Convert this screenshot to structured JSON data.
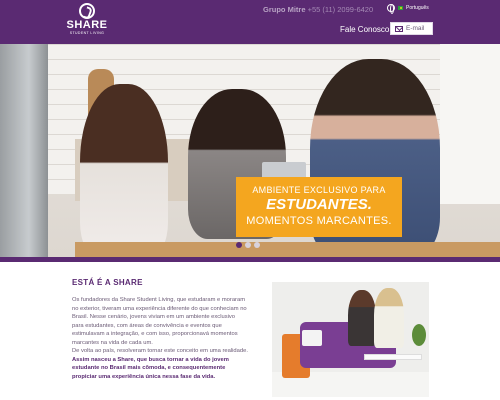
{
  "header": {
    "logo_name": "SHARE",
    "logo_sub": "STUDENT LIVING",
    "group_name": "Grupo Mitre",
    "phone": "+55 (11) 2099-6420",
    "language": "Português",
    "contact_label": "Fale Conosco:",
    "email_placeholder": "E-mail"
  },
  "hero": {
    "banner_line1": "AMBIENTE EXCLUSIVO PARA",
    "banner_line2": "ESTUDANTES.",
    "banner_line3": "MOMENTOS MARCANTES.",
    "slide_count": 3,
    "active_slide": 1
  },
  "about": {
    "title": "ESTÁ É A SHARE",
    "paragraph": "Os fundadores da Share Student Living, que estudaram e moraram no exterior, tiveram uma experiência diferente do que conheciam no Brasil. Nesse cenário, jovens viviam em um ambiente exclusivo para estudantes, com áreas de convivência e eventos que estimulavam a integração, e com isso, proporcionavá momentos marcantes na vida de cada um.",
    "paragraph2": "De volta ao país, resolveram tornar este conceito em uma realidade.",
    "highlight": "Assim nasceu a Share, que busca tornar a vida do jovem estudante no Brasil mais cômoda, e consequentemente propiciar uma experiência única nessa fase da vida."
  },
  "colors": {
    "brand_purple": "#5a2a72",
    "banner_orange": "#f4a61f"
  }
}
